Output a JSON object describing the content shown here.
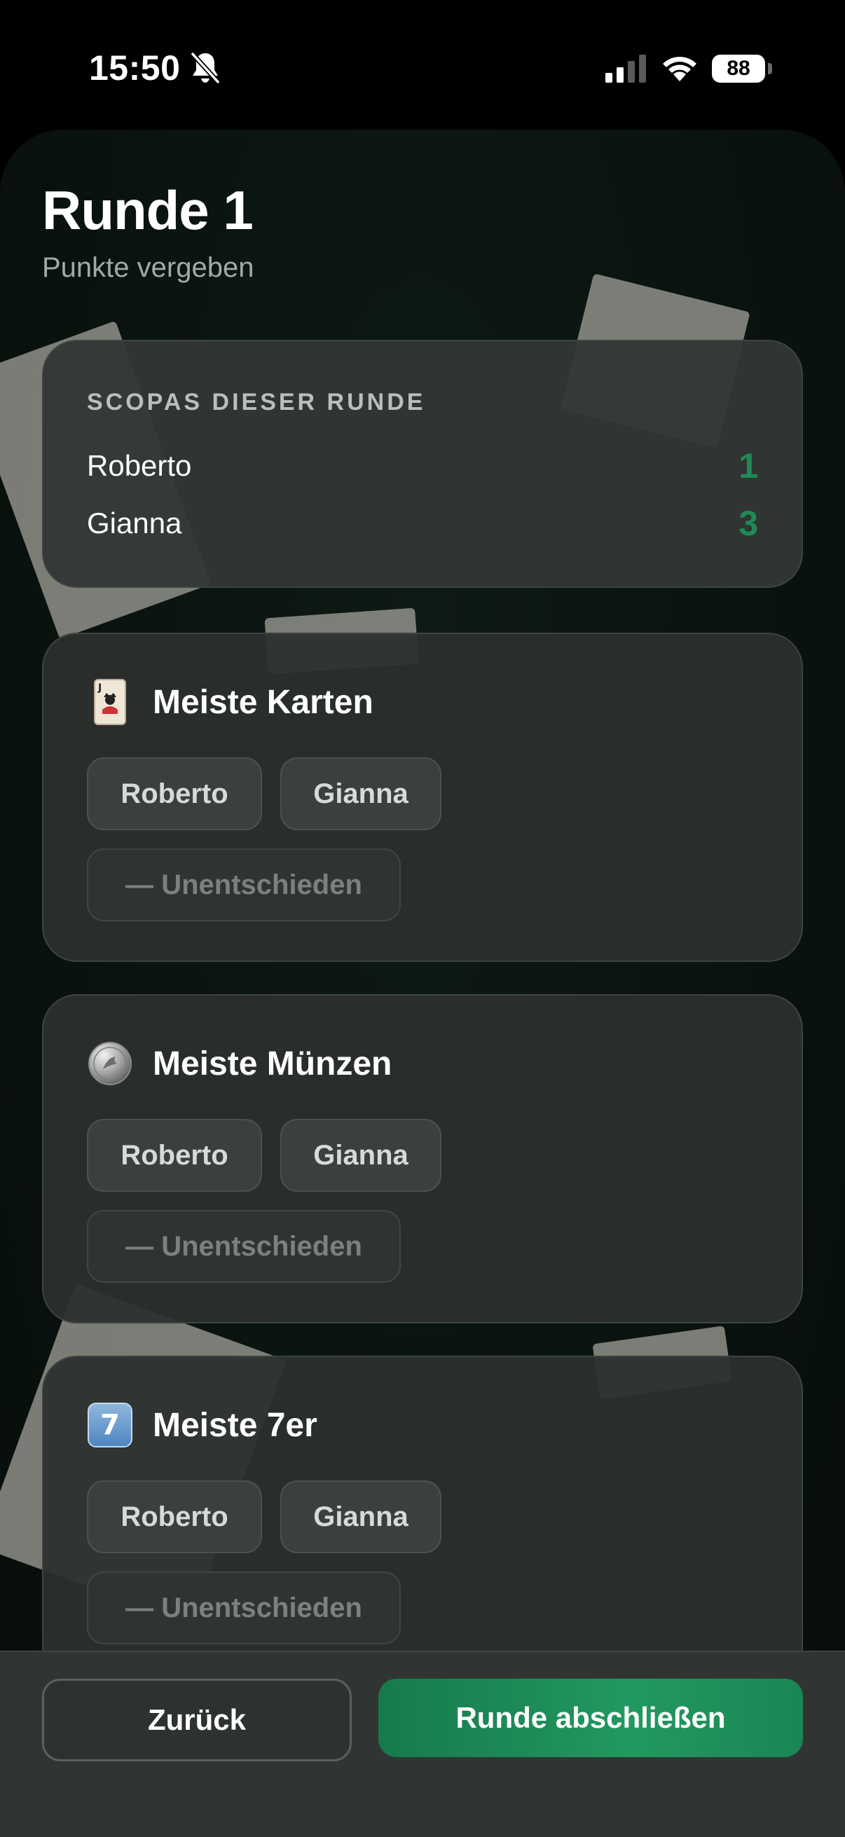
{
  "status_bar": {
    "time": "15:50",
    "battery": "88",
    "icons": [
      "bell-slash-icon",
      "signal-icon",
      "wifi-icon",
      "battery-icon"
    ]
  },
  "header": {
    "title": "Runde 1",
    "subtitle": "Punkte vergeben"
  },
  "scopas": {
    "heading": "SCOPAS DIESER RUNDE",
    "rows": [
      {
        "name": "Roberto",
        "value": "1"
      },
      {
        "name": "Gianna",
        "value": "3"
      }
    ],
    "value_color": "#1f8a56"
  },
  "categories": [
    {
      "icon": "playing-card-icon",
      "title": "Meiste Karten",
      "option_a": "Roberto",
      "option_b": "Gianna",
      "tie": "— Unentschieden"
    },
    {
      "icon": "coin-icon",
      "title": "Meiste Münzen",
      "option_a": "Roberto",
      "option_b": "Gianna",
      "tie": "— Unentschieden"
    },
    {
      "icon": "keycap-seven-icon",
      "title": "Meiste 7er",
      "option_a": "Roberto",
      "option_b": "Gianna",
      "tie": "— Unentschieden",
      "icon_text": "7"
    }
  ],
  "footer": {
    "back_label": "Zurück",
    "finish_label": "Runde abschließen",
    "accent": "#1f8a56"
  }
}
